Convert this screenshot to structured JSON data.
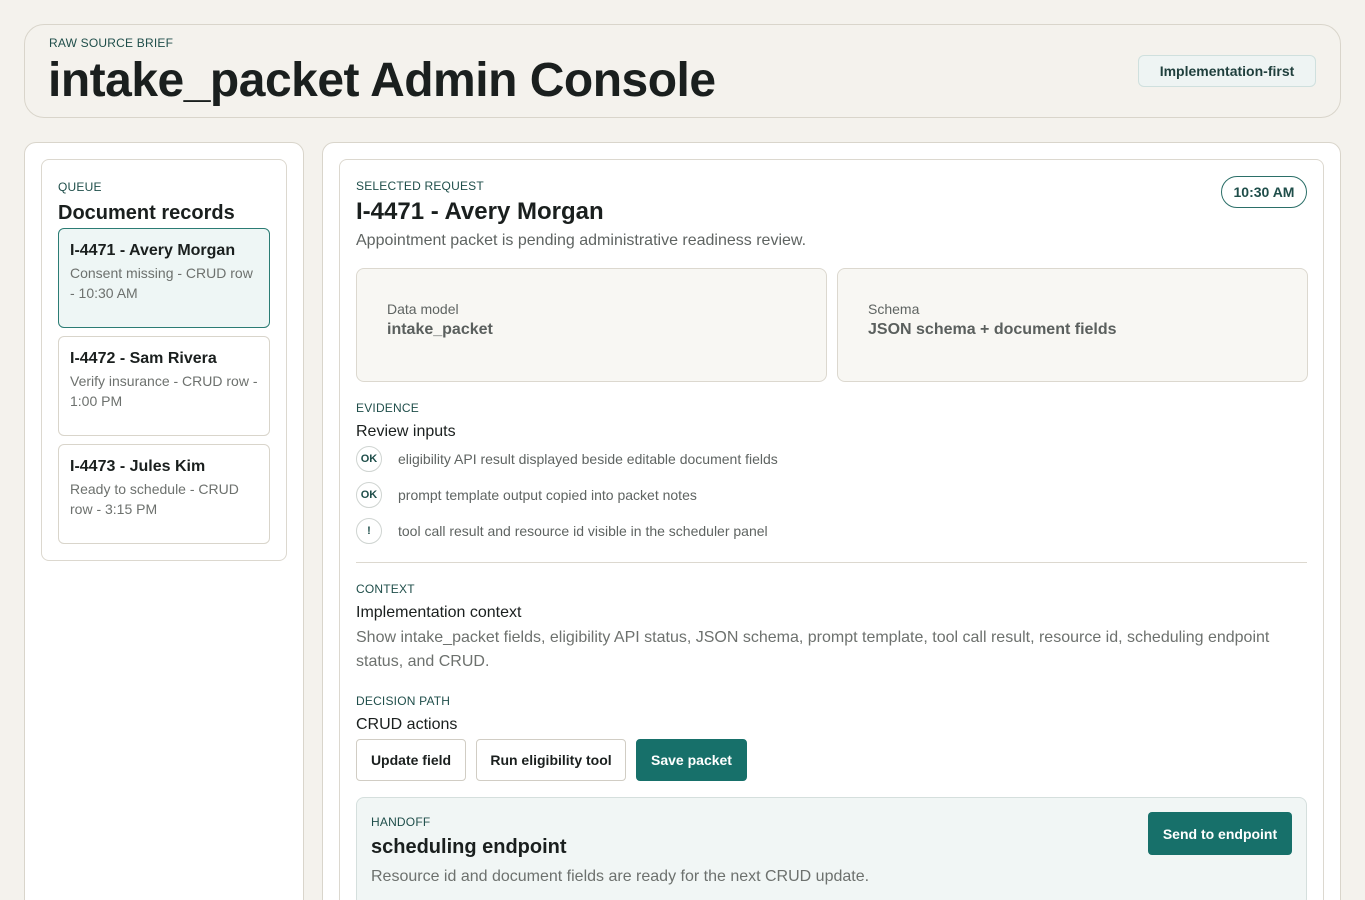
{
  "header": {
    "eyebrow": "RAW SOURCE BRIEF",
    "title": "intake_packet Admin Console",
    "mode_badge": "Implementation-first"
  },
  "queue": {
    "eyebrow": "QUEUE",
    "title": "Document records",
    "records": [
      {
        "title": "I-4471 - Avery Morgan",
        "subtitle": "Consent missing - CRUD row - 10:30 AM",
        "active": true
      },
      {
        "title": "I-4472 - Sam Rivera",
        "subtitle": "Verify insurance - CRUD row - 1:00 PM",
        "active": false
      },
      {
        "title": "I-4473 - Jules Kim",
        "subtitle": "Ready to schedule - CRUD row - 3:15 PM",
        "active": false
      }
    ]
  },
  "detail": {
    "eyebrow": "SELECTED REQUEST",
    "title": "I-4471 - Avery Morgan",
    "description": "Appointment packet is pending administrative readiness review.",
    "time": "10:30 AM",
    "info": [
      {
        "label": "Data model",
        "value": "intake_packet"
      },
      {
        "label": "Schema",
        "value": "JSON schema + document fields"
      }
    ],
    "evidence": {
      "eyebrow": "EVIDENCE",
      "title": "Review inputs",
      "items": [
        {
          "badge": "OK",
          "text": "eligibility API result displayed beside editable document fields"
        },
        {
          "badge": "OK",
          "text": "prompt template output copied into packet notes"
        },
        {
          "badge": "!",
          "text": "tool call result and resource id visible in the scheduler panel"
        }
      ]
    },
    "context": {
      "eyebrow": "CONTEXT",
      "title": "Implementation context",
      "text": "Show intake_packet fields, eligibility API status, JSON schema, prompt template, tool call result, resource id, scheduling endpoint status, and CRUD."
    },
    "decision": {
      "eyebrow": "DECISION PATH",
      "title": "CRUD actions",
      "buttons": [
        "Update field",
        "Run eligibility tool",
        "Save packet"
      ]
    },
    "handoff": {
      "eyebrow": "HANDOFF",
      "title": "scheduling endpoint",
      "description": "Resource id and document fields are ready for the next CRUD update.",
      "button": "Send to endpoint"
    }
  }
}
